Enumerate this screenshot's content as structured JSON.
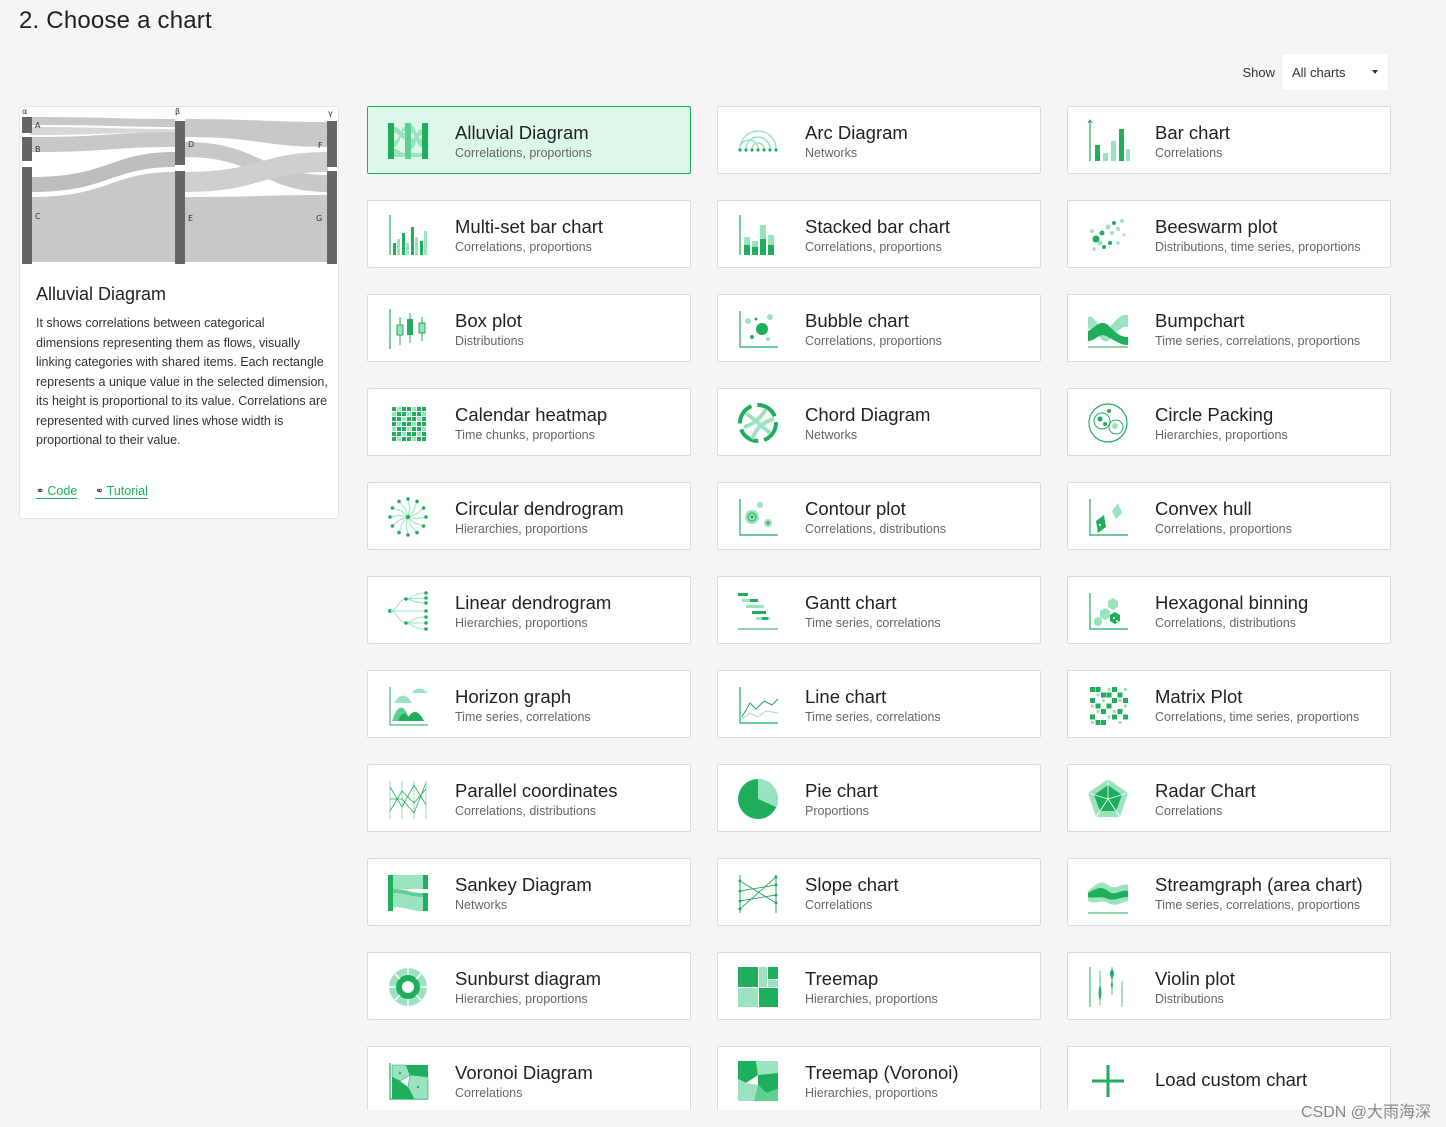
{
  "title": "2. Choose a chart",
  "filter": {
    "label": "Show",
    "value": "All charts"
  },
  "preview": {
    "image_labels": {
      "dim1": "α",
      "dim2": "β",
      "dim3": "γ",
      "a": "A",
      "b": "B",
      "c": "C",
      "d": "D",
      "e": "E",
      "f": "F",
      "g": "G"
    },
    "title": "Alluvial Diagram",
    "description": "It shows correlations between categorical dimensions representing them as flows, visually linking categories with shared items. Each rectangle represents a unique value in the selected dimension, its height is proportional to its value. Correlations are represented with curved lines whose width is proportional to their value.",
    "links": {
      "code": "Code",
      "tutorial": "Tutorial"
    }
  },
  "accent": "#1fae5b",
  "charts": [
    {
      "name": "Alluvial Diagram",
      "category": "Correlations, proportions",
      "icon": "alluvial-icon",
      "selected": true
    },
    {
      "name": "Arc Diagram",
      "category": "Networks",
      "icon": "arc-icon"
    },
    {
      "name": "Bar chart",
      "category": "Correlations",
      "icon": "bar-icon"
    },
    {
      "name": "Multi-set bar chart",
      "category": "Correlations, proportions",
      "icon": "multiset-bar-icon"
    },
    {
      "name": "Stacked bar chart",
      "category": "Correlations, proportions",
      "icon": "stacked-bar-icon"
    },
    {
      "name": "Beeswarm plot",
      "category": "Distributions, time series, proportions",
      "icon": "beeswarm-icon"
    },
    {
      "name": "Box plot",
      "category": "Distributions",
      "icon": "boxplot-icon"
    },
    {
      "name": "Bubble chart",
      "category": "Correlations, proportions",
      "icon": "bubble-icon"
    },
    {
      "name": "Bumpchart",
      "category": "Time series, correlations, proportions",
      "icon": "bumpchart-icon"
    },
    {
      "name": "Calendar heatmap",
      "category": "Time chunks, proportions",
      "icon": "calendar-icon"
    },
    {
      "name": "Chord Diagram",
      "category": "Networks",
      "icon": "chord-icon"
    },
    {
      "name": "Circle Packing",
      "category": "Hierarchies, proportions",
      "icon": "circle-packing-icon"
    },
    {
      "name": "Circular dendrogram",
      "category": "Hierarchies, proportions",
      "icon": "circular-dendrogram-icon"
    },
    {
      "name": "Contour plot",
      "category": "Correlations, distributions",
      "icon": "contour-icon"
    },
    {
      "name": "Convex hull",
      "category": "Correlations, proportions",
      "icon": "convex-hull-icon"
    },
    {
      "name": "Linear dendrogram",
      "category": "Hierarchies, proportions",
      "icon": "linear-dendrogram-icon"
    },
    {
      "name": "Gantt chart",
      "category": "Time series, correlations",
      "icon": "gantt-icon"
    },
    {
      "name": "Hexagonal binning",
      "category": "Correlations, distributions",
      "icon": "hexbin-icon"
    },
    {
      "name": "Horizon graph",
      "category": "Time series, correlations",
      "icon": "horizon-icon"
    },
    {
      "name": "Line chart",
      "category": "Time series, correlations",
      "icon": "line-icon"
    },
    {
      "name": "Matrix Plot",
      "category": "Correlations, time series, proportions",
      "icon": "matrix-icon"
    },
    {
      "name": "Parallel coordinates",
      "category": "Correlations, distributions",
      "icon": "parallel-icon"
    },
    {
      "name": "Pie chart",
      "category": "Proportions",
      "icon": "pie-icon"
    },
    {
      "name": "Radar Chart",
      "category": "Correlations",
      "icon": "radar-icon"
    },
    {
      "name": "Sankey Diagram",
      "category": "Networks",
      "icon": "sankey-icon"
    },
    {
      "name": "Slope chart",
      "category": "Correlations",
      "icon": "slope-icon"
    },
    {
      "name": "Streamgraph (area chart)",
      "category": "Time series, correlations, proportions",
      "icon": "streamgraph-icon"
    },
    {
      "name": "Sunburst diagram",
      "category": "Hierarchies, proportions",
      "icon": "sunburst-icon"
    },
    {
      "name": "Treemap",
      "category": "Hierarchies, proportions",
      "icon": "treemap-icon"
    },
    {
      "name": "Violin plot",
      "category": "Distributions",
      "icon": "violin-icon"
    },
    {
      "name": "Voronoi Diagram",
      "category": "Correlations",
      "icon": "voronoi-icon"
    },
    {
      "name": "Treemap (Voronoi)",
      "category": "Hierarchies, proportions",
      "icon": "voronoi-treemap-icon"
    },
    {
      "name": "Load custom chart",
      "category": "",
      "icon": "plus-icon",
      "custom": true
    }
  ],
  "watermark": "CSDN @大雨海深"
}
